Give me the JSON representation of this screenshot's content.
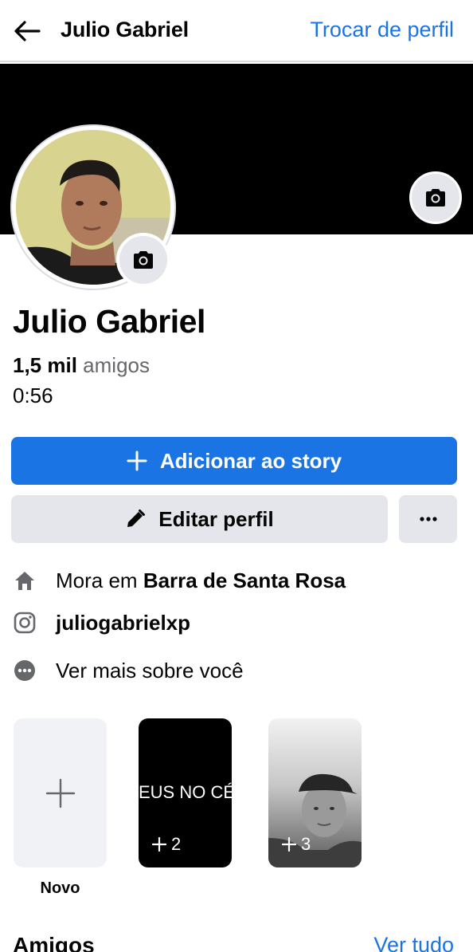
{
  "header": {
    "title": "Julio Gabriel",
    "switch_profile": "Trocar de perfil"
  },
  "profile": {
    "name": "Julio Gabriel",
    "friends_count": "1,5 mil",
    "friends_label": "amigos",
    "time": "0:56"
  },
  "actions": {
    "add_story": "Adicionar ao story",
    "edit_profile": "Editar perfil"
  },
  "info": {
    "lives_in_prefix": "Mora em",
    "lives_in_city": "Barra de Santa Rosa",
    "instagram": "juliogabrielxp",
    "see_more": "Ver mais sobre você"
  },
  "stories": {
    "new_label": "Novo",
    "items": [
      {
        "text": "EUS NO CÉ",
        "count": "2"
      },
      {
        "text": "",
        "count": "3"
      }
    ]
  },
  "friends_section": {
    "title": "Amigos",
    "see_all": "Ver tudo"
  },
  "colors": {
    "accent": "#1b74e4",
    "secondary_button": "#e4e6eb",
    "muted_text": "#65676b"
  }
}
